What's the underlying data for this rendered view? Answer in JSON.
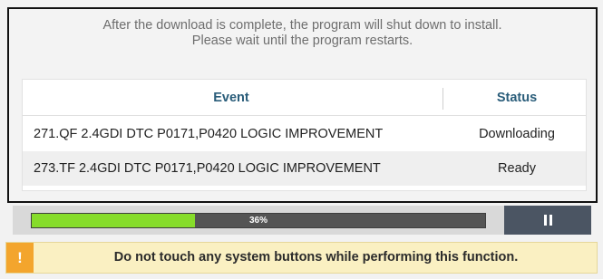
{
  "message": {
    "line1": "After the download is complete, the program will shut down to install.",
    "line2": "Please wait until the program restarts."
  },
  "table": {
    "headers": {
      "event": "Event",
      "status": "Status"
    },
    "rows": [
      {
        "event": "271.QF 2.4GDI DTC P0171,P0420 LOGIC IMPROVEMENT",
        "status": "Downloading"
      },
      {
        "event": "273.TF 2.4GDI DTC P0171,P0420 LOGIC IMPROVEMENT",
        "status": "Ready"
      }
    ]
  },
  "progress": {
    "label": "36%",
    "fraction": 0.36,
    "fill_color": "#86dc2a"
  },
  "pause_button": {
    "icon": "pause-icon"
  },
  "warning": {
    "icon": "!",
    "text": "Do not touch any system buttons while performing this function.",
    "accent_color": "#f3a52d"
  }
}
